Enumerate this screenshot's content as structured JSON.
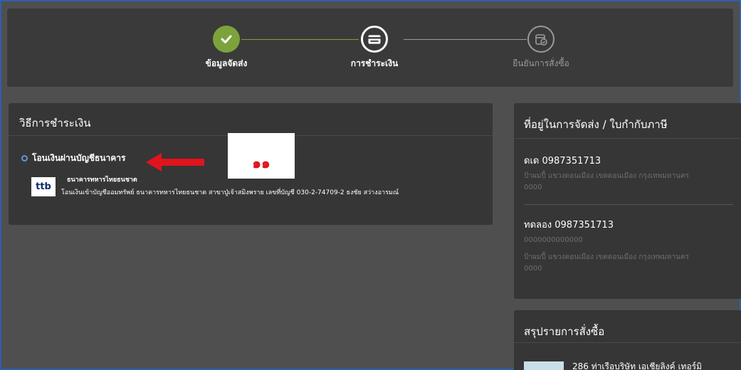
{
  "steps": [
    {
      "label": "ข้อมูลจัดส่ง",
      "state": "done",
      "icon": "check-icon"
    },
    {
      "label": "การชำระเงิน",
      "state": "current",
      "icon": "credit-card-icon"
    },
    {
      "label": "ยืนยันการสั่งซื้อ",
      "state": "pending",
      "icon": "confirm-order-icon"
    }
  ],
  "payment": {
    "title": "วิธีการชำระเงิน",
    "method_label": "โอนเงินผ่านบัญชีธนาคาร",
    "bank_logo_text": "ttb",
    "bank_name": "ธนาคารทหารไทยธนชาต",
    "bank_detail": "โอนเงินเข้าบัญชีออมทรัพย์ ธนาคารทหารไทยธนชาต สาขาปู่เจ้าสมิงพราย เลขที่บัญชี 030-2-74709-2 ธงชัย สว่างอารมณ์"
  },
  "annotation": {
    "text": "๑๑",
    "arrow_color": "#e0141c"
  },
  "address": {
    "title": "ที่อยู่ในการจัดส่ง / ใบกำกับภาษี",
    "entries": [
      {
        "name": "ดเด 0987351713",
        "line1": "ป้าผมปี้ แขวงดอนเมือง เขตดอนเมือง กรุงเทพมหานคร",
        "line2": "0000"
      },
      {
        "name": "ทดลอง 0987351713",
        "line1": "0000000000000",
        "line2": "ป้าผมปี้ แขวงดอนเมือง เขตดอนเมือง กรุงเทพมหานคร",
        "line3": "0000"
      }
    ]
  },
  "summary": {
    "title": "สรุปรายการสั่งซื้อ",
    "product_name": "286 ท่าเรือบริษัท เอเชียลิงค์ เทอร์มิ"
  },
  "colors": {
    "accent_done": "#7ca33b",
    "radio": "#5b9bd5",
    "annotation": "#e0141c"
  }
}
